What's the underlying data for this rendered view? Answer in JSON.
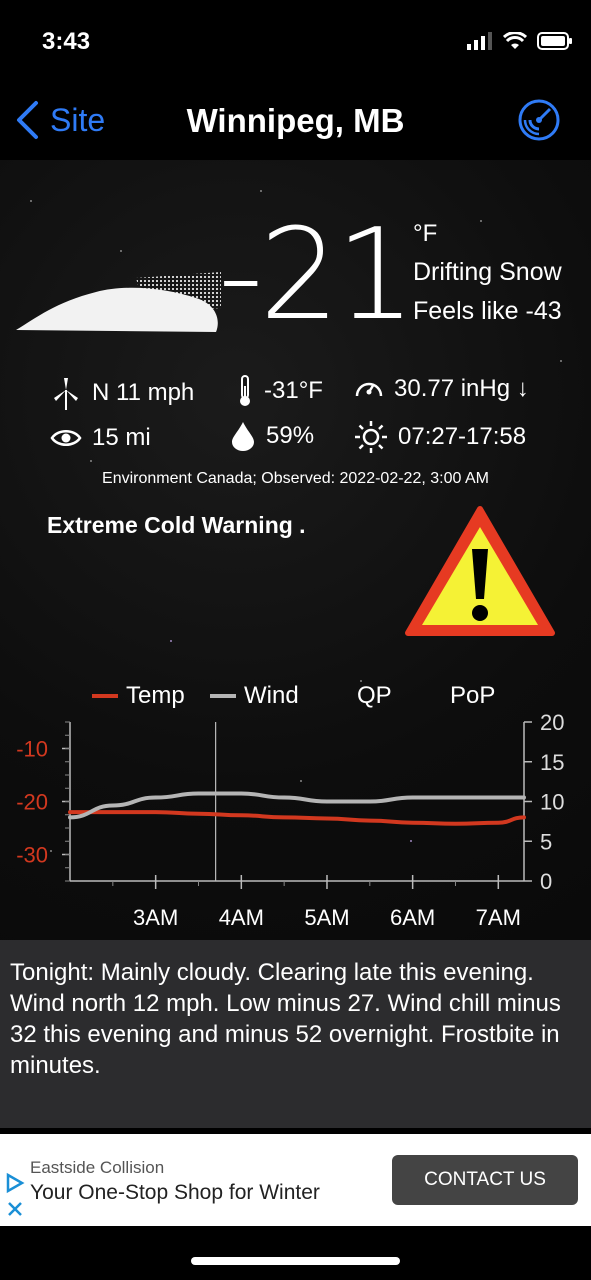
{
  "status": {
    "time": "3:43"
  },
  "nav": {
    "back_label": "Site",
    "title": "Winnipeg, MB"
  },
  "current": {
    "temp": "-21",
    "unit": "°F",
    "condition": "Drifting Snow",
    "feels_like": "Feels like -43",
    "wind": "N 11 mph",
    "dewpoint": "-31°F",
    "pressure": "30.77 inHg ↓",
    "visibility": "15 mi",
    "humidity": "59%",
    "sun": "07:27-17:58",
    "source": "Environment Canada; Observed: 2022-02-22, 3:00 AM"
  },
  "warning": {
    "text": "Extreme Cold Warning ."
  },
  "legend": {
    "temp": "Temp",
    "wind": "Wind",
    "qp": "QP",
    "pop": "PoP"
  },
  "chart_data": {
    "type": "line",
    "categories": [
      "3AM",
      "4AM",
      "5AM",
      "6AM",
      "7AM"
    ],
    "x": [
      2.0,
      2.5,
      3.0,
      3.5,
      4.0,
      4.5,
      5.0,
      5.5,
      6.0,
      6.5,
      7.0,
      7.3
    ],
    "left_axis": {
      "ticks": [
        "-10",
        "-20",
        "-30"
      ],
      "values": [
        -10,
        -20,
        -30
      ],
      "ylim": [
        -35,
        -5
      ]
    },
    "right_axis": {
      "ticks": [
        "20",
        "15",
        "10",
        "5",
        "0"
      ],
      "values": [
        20,
        15,
        10,
        5,
        0
      ],
      "ylim": [
        0,
        20
      ]
    },
    "series": [
      {
        "name": "Temp",
        "color": "#d2381f",
        "axis": "left",
        "values": [
          -22,
          -22,
          -22,
          -22.3,
          -22.6,
          -23,
          -23.2,
          -23.6,
          -24,
          -24.2,
          -24,
          -23
        ]
      },
      {
        "name": "Wind",
        "color": "#b5b5b5",
        "axis": "right",
        "values": [
          8,
          9.5,
          10.5,
          11,
          11,
          10.5,
          10,
          10,
          10.5,
          10.5,
          10.5,
          10.5
        ]
      }
    ],
    "current_time_marker": 3.7
  },
  "forecast": {
    "text": "Tonight:  Mainly cloudy. Clearing late this evening. Wind north 12 mph. Low minus 27. Wind chill minus 32 this evening and minus 52 overnight. Frostbite in minutes."
  },
  "ad": {
    "sponsor": "Eastside Collision",
    "headline": "Your One-Stop Shop for Winter",
    "cta": "CONTACT US"
  }
}
